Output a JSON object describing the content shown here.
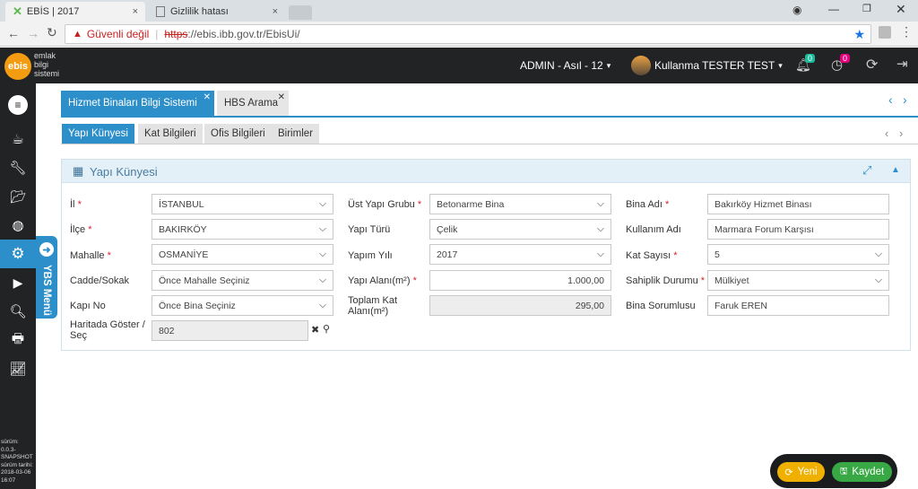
{
  "browser": {
    "tabs": [
      {
        "title": "EBİS | 2017",
        "close": "×"
      },
      {
        "title": "Gizlilik hatası",
        "close": "×"
      }
    ],
    "security_label": "Güvenli değil",
    "url_https": "https",
    "url_rest": "://ebis.ibb.gov.tr/EbisUi/"
  },
  "app": {
    "logo_text": "ebis",
    "logo_subtitle": [
      "emlak",
      "bilgi",
      "sistemi"
    ],
    "role_selector": "ADMIN - Asıl - 12",
    "user_name": "Kullanma TESTER TEST",
    "notification_count": "0",
    "timer_count": "0"
  },
  "sidebar": {
    "ybs_menu_label": "YBS Menü",
    "version_info": [
      "sürüm:",
      "0.0.3-",
      "SNAPSHOT",
      "sürüm tarihi:",
      "2018-03-06",
      "16:07"
    ]
  },
  "page_tabs": [
    {
      "label": "Hizmet Binaları Bilgi Sistemi",
      "active": true
    },
    {
      "label": "HBS Arama",
      "active": false
    }
  ],
  "sub_tabs": [
    {
      "label": "Yapı Künyesi",
      "active": true
    },
    {
      "label": "Kat Bilgileri",
      "active": false
    },
    {
      "label": "Ofis Bilgileri",
      "active": false
    },
    {
      "label": "Birimler",
      "active": false
    }
  ],
  "panel": {
    "title": "Yapı Künyesi"
  },
  "form": {
    "col1": [
      {
        "label": "İl",
        "required": true,
        "value": "İSTANBUL",
        "type": "select"
      },
      {
        "label": "İlçe",
        "required": true,
        "value": "BAKIRKÖY",
        "type": "select"
      },
      {
        "label": "Mahalle",
        "required": true,
        "value": "OSMANİYE",
        "type": "select"
      },
      {
        "label": "Cadde/Sokak",
        "required": false,
        "value": "Önce Mahalle Seçiniz",
        "type": "select"
      },
      {
        "label": "Kapı No",
        "required": false,
        "value": "Önce Bina Seçiniz",
        "type": "select"
      },
      {
        "label": "Haritada Göster / Seç",
        "required": false,
        "value": "802",
        "type": "map"
      }
    ],
    "col2": [
      {
        "label": "Üst Yapı Grubu",
        "required": true,
        "value": "Betonarme Bina",
        "type": "select"
      },
      {
        "label": "Yapı Türü",
        "required": false,
        "value": "Çelik",
        "type": "select"
      },
      {
        "label": "Yapım Yılı",
        "required": false,
        "value": "2017",
        "type": "select"
      },
      {
        "label": "Yapı Alanı(m²)",
        "required": true,
        "value": "1.000,00",
        "type": "number"
      },
      {
        "label": "Toplam Kat Alanı(m²)",
        "required": false,
        "value": "295,00",
        "type": "number-ro"
      }
    ],
    "col3": [
      {
        "label": "Bina Adı",
        "required": true,
        "value": "Bakırköy Hizmet Binası",
        "type": "text"
      },
      {
        "label": "Kullanım Adı",
        "required": false,
        "value": "Marmara Forum Karşısı",
        "type": "text"
      },
      {
        "label": "Kat Sayısı",
        "required": true,
        "value": "5",
        "type": "select"
      },
      {
        "label": "Sahiplik Durumu",
        "required": true,
        "value": "Mülkiyet",
        "type": "select"
      },
      {
        "label": "Bina Sorumlusu",
        "required": false,
        "value": "Faruk EREN",
        "type": "text"
      }
    ]
  },
  "actions": {
    "new_label": "Yeni",
    "save_label": "Kaydet"
  },
  "colors": {
    "accent": "#2d8fc9",
    "dark_bar": "#222325",
    "required": "#d9232d",
    "new_button": "#f0b000",
    "save_button": "#37a844",
    "badge_green": "#1abc9c",
    "badge_pink": "#e5007e"
  }
}
